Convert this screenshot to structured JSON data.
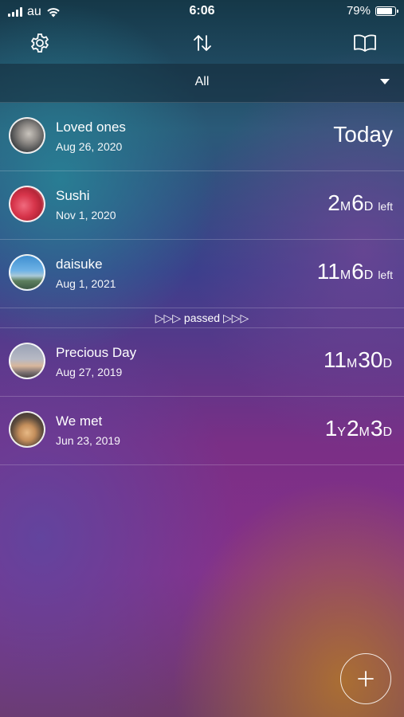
{
  "status_bar": {
    "carrier": "au",
    "time": "6:06",
    "battery_percent": "79%",
    "battery_level": 0.79
  },
  "toolbar": {
    "settings_icon": "gear-icon",
    "sort_icon": "sort-arrows-icon",
    "book_icon": "book-icon"
  },
  "filter": {
    "selected": "All"
  },
  "events": [
    {
      "title": "Loved ones",
      "date": "Aug 26, 2020",
      "count": "Today"
    },
    {
      "title": "Sushi",
      "date": "Nov 1, 2020",
      "count": [
        {
          "n": "2",
          "u": "M"
        },
        {
          "n": "6",
          "u": "D"
        }
      ],
      "suffix": "left"
    },
    {
      "title": "daisuke",
      "date": "Aug 1, 2021",
      "count": [
        {
          "n": "11",
          "u": "M"
        },
        {
          "n": "6",
          "u": "D"
        }
      ],
      "suffix": "left"
    }
  ],
  "divider_label": "▷▷▷ passed ▷▷▷",
  "past_events": [
    {
      "title": "Precious Day",
      "date": "Aug 27, 2019",
      "count": [
        {
          "n": "11",
          "u": "M"
        },
        {
          "n": "30",
          "u": "D"
        }
      ]
    },
    {
      "title": "We met",
      "date": "Jun 23, 2019",
      "count": [
        {
          "n": "1",
          "u": "Y"
        },
        {
          "n": "2",
          "u": "M"
        },
        {
          "n": "3",
          "u": "D"
        }
      ]
    }
  ],
  "colors": {
    "accent": "#ffffff",
    "fab_border": "#e8d8e0"
  },
  "fab_icon": "plus-icon"
}
